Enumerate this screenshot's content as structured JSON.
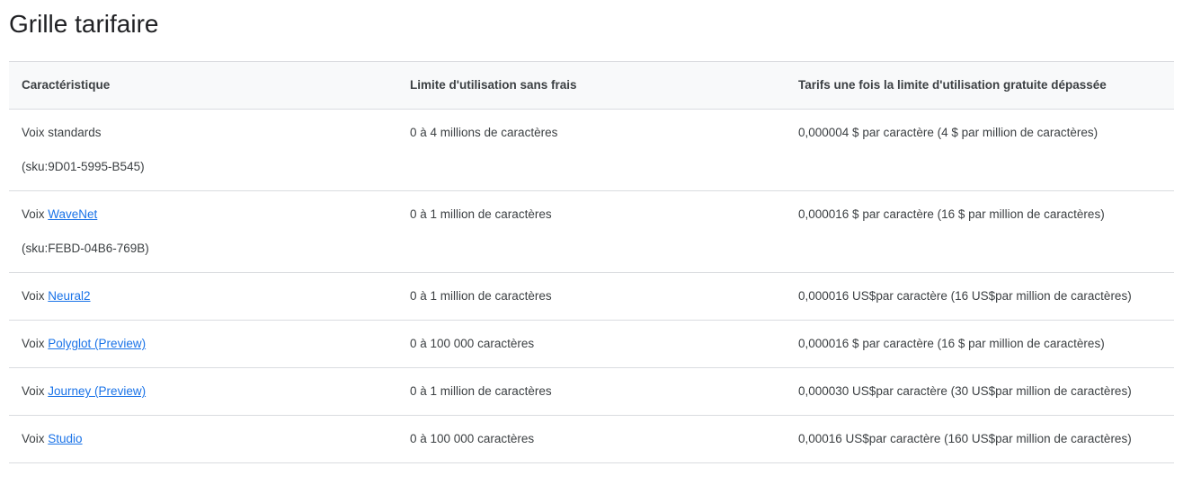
{
  "page": {
    "title": "Grille tarifaire"
  },
  "table": {
    "headers": [
      "Caractéristique",
      "Limite d'utilisation sans frais",
      "Tarifs une fois la limite d'utilisation gratuite dépassée"
    ],
    "rows": [
      {
        "prefix": "Voix standards",
        "link": "",
        "sku": "(sku:9D01-5995-B545)",
        "limit": "0 à 4 millions de caractères",
        "price": "0,000004 $ par caractère (4 $ par million de caractères)"
      },
      {
        "prefix": "Voix ",
        "link": "WaveNet",
        "sku": "(sku:FEBD-04B6-769B)",
        "limit": "0 à 1 million de caractères",
        "price": "0,000016 $ par caractère (16 $ par million de caractères)"
      },
      {
        "prefix": "Voix ",
        "link": "Neural2",
        "limit": "0 à 1 million de caractères",
        "price": "0,000016 US$par caractère (16 US$par million de caractères)"
      },
      {
        "prefix": "Voix ",
        "link": "Polyglot (Preview)",
        "limit": "0 à 100 000 caractères",
        "price": "0,000016 $ par caractère (16 $ par million de caractères)"
      },
      {
        "prefix": "Voix ",
        "link": "Journey (Preview)",
        "limit": "0 à 1 million de caractères",
        "price": "0,000030 US$par caractère (30 US$par million de caractères)"
      },
      {
        "prefix": "Voix ",
        "link": "Studio",
        "limit": "0 à 100 000 caractères",
        "price": "0,00016 US$par caractère (160 US$par million de caractères)"
      }
    ]
  },
  "colors": {
    "link": "#1a73e8",
    "header_bg": "#f8f9fa",
    "border": "#dadce0",
    "text": "#3c4043"
  }
}
